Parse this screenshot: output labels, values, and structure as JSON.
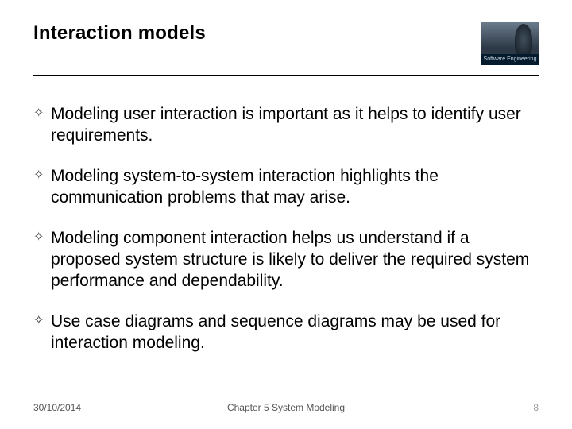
{
  "header": {
    "title": "Interaction models",
    "logo_label": "Software Engineering"
  },
  "bullets": [
    {
      "text": "Modeling user interaction is important as it helps to identify user requirements."
    },
    {
      "text": "Modeling system-to-system interaction highlights the communication problems that may arise."
    },
    {
      "text": "Modeling component interaction helps us understand if a proposed system structure is likely to deliver the required system performance and dependability."
    },
    {
      "text": "Use case diagrams and sequence diagrams may be used for interaction modeling."
    }
  ],
  "footer": {
    "date": "30/10/2014",
    "chapter": "Chapter 5 System Modeling",
    "page": "8"
  },
  "marker": "✧"
}
